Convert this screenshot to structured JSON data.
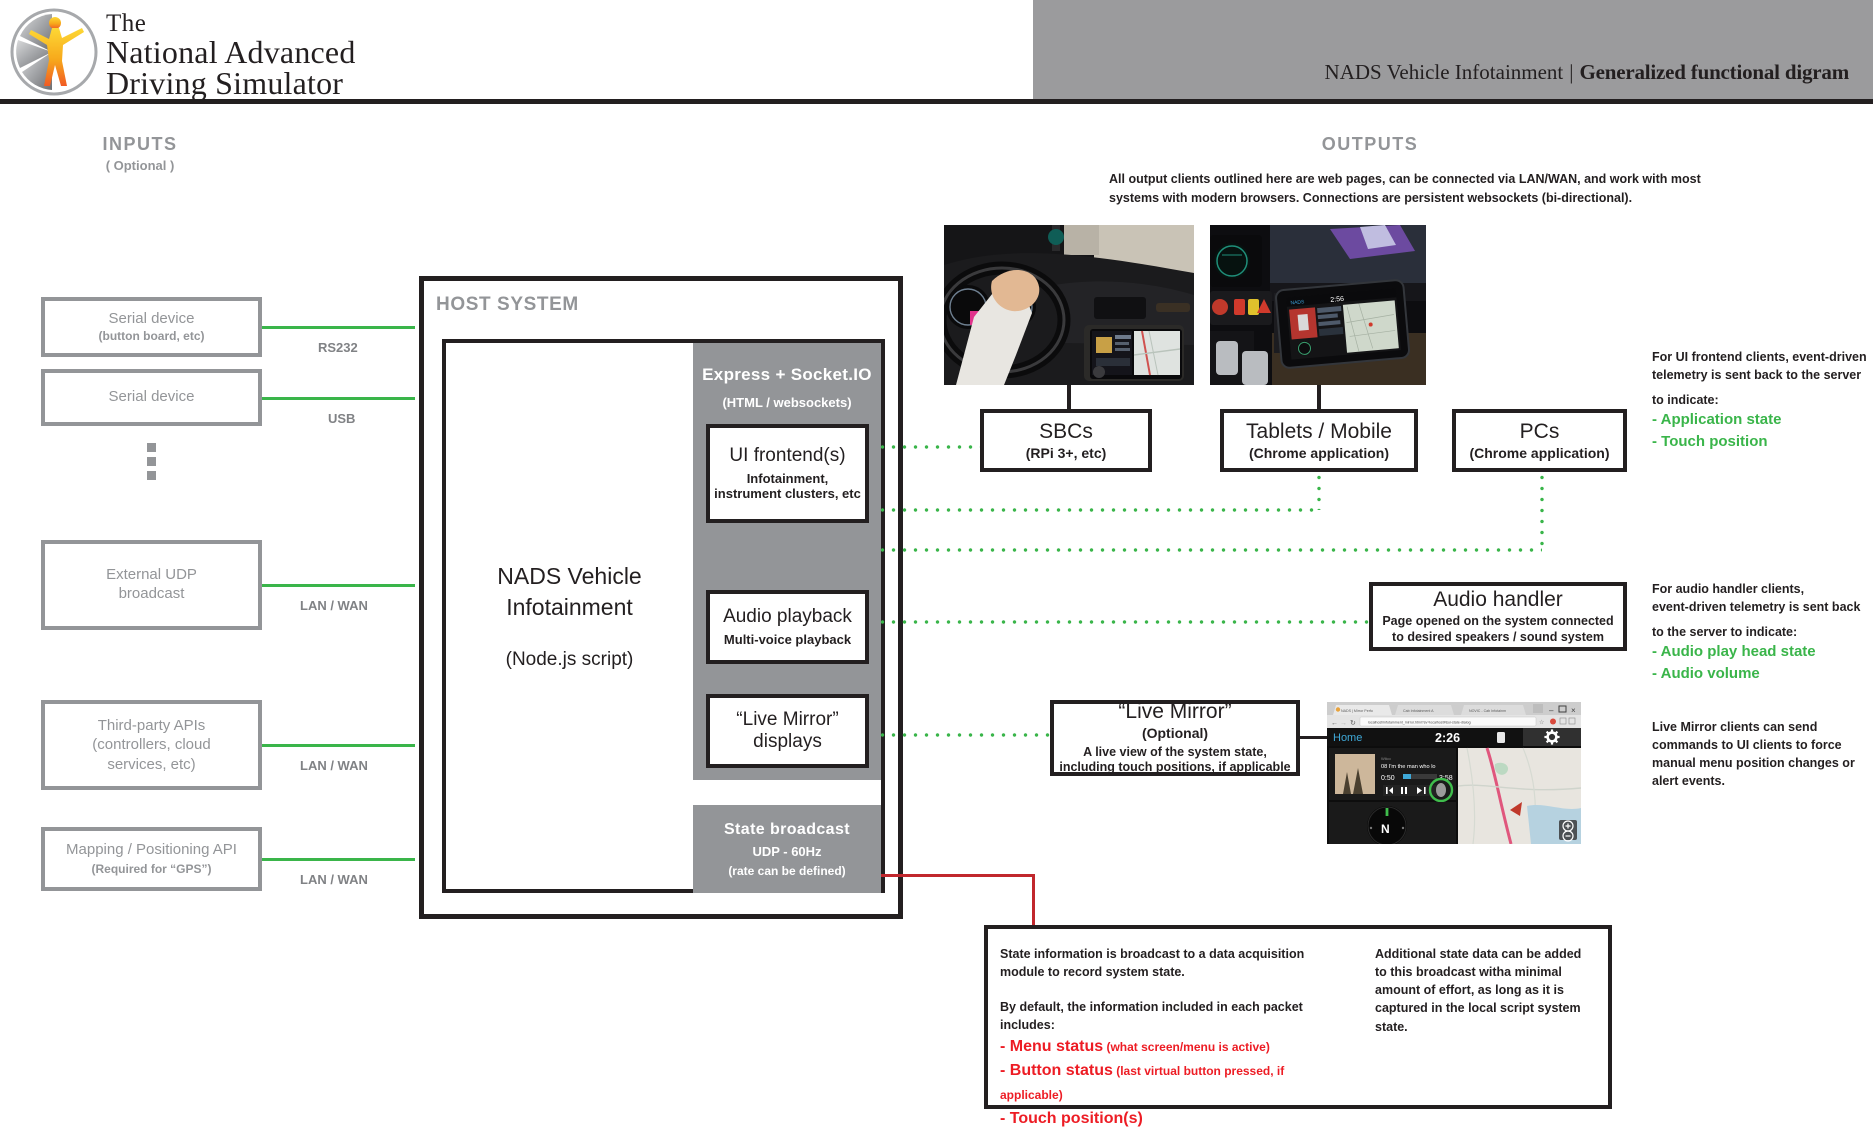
{
  "header": {
    "logo_line1": "The",
    "logo_line2": "National Advanced",
    "logo_line3": "Driving Simulator",
    "title_left": "NADS Vehicle Infotainment",
    "title_sep": "|",
    "title_right": "Generalized functional digram"
  },
  "inputs": {
    "heading": "INPUTS",
    "subheading": "( Optional )",
    "items": [
      {
        "title": "Serial device",
        "sub": "(button board, etc)",
        "link": "RS232"
      },
      {
        "title": "Serial device",
        "sub": "",
        "link": "USB"
      },
      {
        "title": "External UDP broadcast",
        "sub": "",
        "link": "LAN / WAN"
      },
      {
        "title": "Third-party APIs (controllers, cloud services, etc)",
        "sub": "",
        "link": "LAN / WAN"
      },
      {
        "title": "Mapping / Positioning API",
        "sub": "(Required for “GPS”)",
        "link": "LAN / WAN"
      }
    ]
  },
  "host": {
    "title": "HOST SYSTEM",
    "main_name_line1": "NADS Vehicle",
    "main_name_line2": "Infotainment",
    "main_sub": "(Node.js script)",
    "express": {
      "title": "Express + Socket.IO",
      "sub": "(HTML / websockets)"
    },
    "modules": [
      {
        "title": "UI frontend(s)",
        "sub": "Infotainment, instrument clusters, etc"
      },
      {
        "title": "Audio playback",
        "sub": "Multi-voice playback"
      },
      {
        "title": "“Live Mirror” displays",
        "sub": ""
      }
    ],
    "state_broadcast": {
      "title": "State broadcast",
      "rate": "UDP - 60Hz",
      "note": "(rate can be defined)"
    }
  },
  "outputs": {
    "heading": "OUTPUTS",
    "description": "All output clients outlined here are web pages, can be connected via LAN/WAN, and work with most systems with modern browsers. Connections are persistent websockets (bi-directional).",
    "clients": [
      {
        "title": "SBCs",
        "sub": "(RPi 3+, etc)"
      },
      {
        "title": "Tablets / Mobile",
        "sub": "(Chrome application)"
      },
      {
        "title": "PCs",
        "sub": "(Chrome application)"
      }
    ],
    "audio_handler": {
      "title": "Audio handler",
      "sub": "Page opened on the system connected to desired speakers / sound system"
    },
    "live_mirror": {
      "title": "“Live Mirror”",
      "optional": "(Optional)",
      "sub": "A live view of the system state, including touch positions, if applicable"
    }
  },
  "notes": {
    "ui_frontend": {
      "line1": "For UI frontend clients, event-driven",
      "line2": "telemetry is sent back to the server",
      "line3": "to indicate:",
      "items": [
        "- Application state",
        "- Touch position"
      ]
    },
    "audio": {
      "line1": "For audio handler clients,",
      "line2": "event-driven telemetry is sent back",
      "line3": "to the server to indicate:",
      "items": [
        "- Audio play head state",
        "- Audio volume"
      ]
    },
    "live_mirror": "Live Mirror clients can send commands to UI clients to force manual menu position changes or alert events."
  },
  "state_info": {
    "para1": "State information is broadcast to a data acquisition module to record system state.",
    "para2": "By default, the information included in each packet includes:",
    "items": [
      {
        "label": "- Menu status",
        "detail": " (what screen/menu is active)"
      },
      {
        "label": "- Button status",
        "detail": " (last virtual button pressed, if applicable)"
      },
      {
        "label": "- Touch position(s)",
        "detail": ""
      }
    ],
    "right_para": "Additional state data can be added to this broadcast witha minimal amount of effort, as long as it is captured in the local script system state."
  },
  "live_mirror_screenshot": {
    "tabs": [
      "NADS | Mirror Perfo…",
      "Cab Infotainment A…",
      "NOVIC - Cab Infotainm…"
    ],
    "url": "localhost/infotainment_mirror.html?sv=localhost#&ui-state-dialog",
    "nav_title": "Home",
    "clock": "2:26",
    "track_artist": "Wilco",
    "track_title": "08 I'm the man who lo",
    "elapsed": "0:50",
    "duration": "3:58",
    "compass": "N",
    "settings_icon": "gear-icon"
  },
  "colors": {
    "green": "#3ab54a",
    "red": "#ed1c24",
    "dark_red": "#c1272d",
    "gray": "#939598",
    "black": "#231f20",
    "header_gray": "#9b9b9d"
  }
}
